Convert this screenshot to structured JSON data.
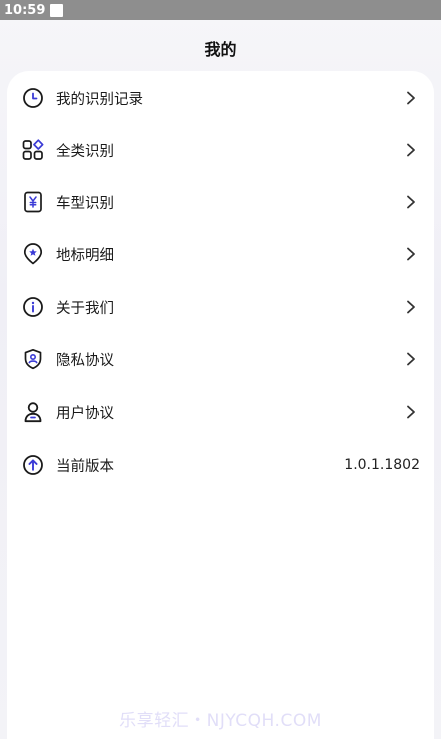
{
  "status": {
    "time": "10:59"
  },
  "page": {
    "title": "我的"
  },
  "menu": [
    {
      "id": "history",
      "icon": "clock-icon",
      "label": "我的识别记录"
    },
    {
      "id": "all",
      "icon": "grid-icon",
      "label": "全类识别"
    },
    {
      "id": "car",
      "icon": "yen-card-icon",
      "label": "车型识别"
    },
    {
      "id": "landmark",
      "icon": "location-star-icon",
      "label": "地标明细"
    },
    {
      "id": "about",
      "icon": "info-icon",
      "label": "关于我们"
    },
    {
      "id": "privacy",
      "icon": "shield-user-icon",
      "label": "隐私协议"
    },
    {
      "id": "user",
      "icon": "person-icon",
      "label": "用户协议"
    }
  ],
  "version": {
    "icon": "arrow-up-circle-icon",
    "label": "当前版本",
    "value": "1.0.1.1802"
  },
  "watermark": "乐享轻汇・NJYCQH.COM",
  "colors": {
    "accent": "#3b3bd6",
    "icon_stroke": "#1a1a1a",
    "statusbar": "#8e8e8e"
  }
}
